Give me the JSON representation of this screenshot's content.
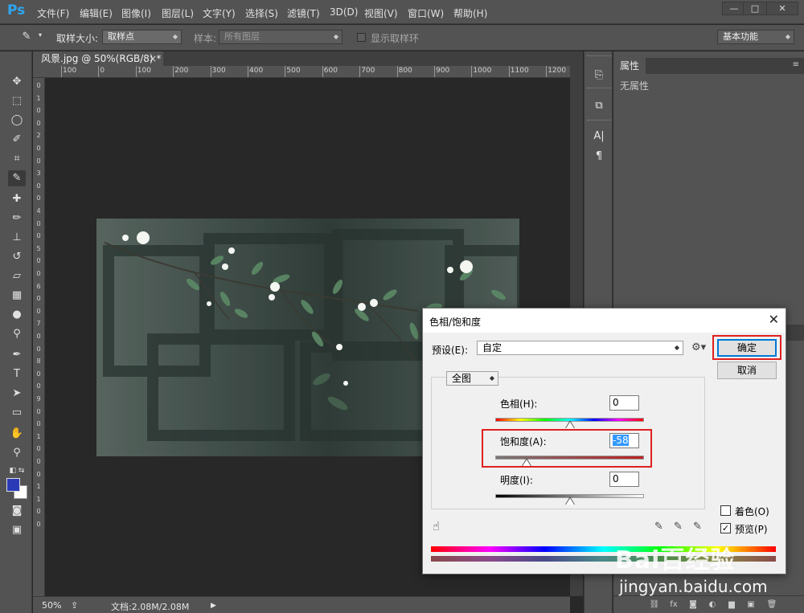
{
  "app": {
    "logo": "Ps"
  },
  "menu": [
    "文件(F)",
    "编辑(E)",
    "图像(I)",
    "图层(L)",
    "文字(Y)",
    "选择(S)",
    "滤镜(T)",
    "3D(D)",
    "视图(V)",
    "窗口(W)",
    "帮助(H)"
  ],
  "window_buttons": {
    "minimize": "—",
    "restore": "□",
    "close": "✕"
  },
  "options": {
    "sample_size_label": "取样大小:",
    "sample_size_value": "取样点",
    "sample_label": "样本:",
    "sample_value": "所有图层",
    "show_ring_label": "显示取样环",
    "workspace": "基本功能"
  },
  "document": {
    "tab_title": "风景.jpg @ 50%(RGB/8) *",
    "tab_close": "×",
    "zoom": "50%",
    "doc_info": "文档:2.08M/2.08M",
    "ruler_top": [
      "100",
      "0",
      "100",
      "200",
      "300",
      "400",
      "500",
      "600",
      "700",
      "800",
      "900",
      "1000",
      "1100",
      "1200"
    ],
    "ruler_left": [
      "0",
      "1",
      "0",
      "0",
      "2",
      "0",
      "0",
      "3",
      "0",
      "0",
      "4",
      "0",
      "0",
      "5",
      "0",
      "0",
      "6",
      "0",
      "0",
      "7",
      "0",
      "0",
      "8",
      "0",
      "0",
      "9",
      "0",
      "0",
      "1",
      "0",
      "0",
      "0",
      "1",
      "1",
      "0",
      "0"
    ]
  },
  "properties_panel": {
    "tab": "属性",
    "empty_text": "无属性"
  },
  "dialog": {
    "title": "色相/饱和度",
    "close": "✕",
    "preset_label": "预设(E):",
    "preset_value": "自定",
    "ok": "确定",
    "cancel": "取消",
    "channel": "全图",
    "hue_label": "色相(H):",
    "hue_value": "0",
    "saturation_label": "饱和度(A):",
    "saturation_value": "-58",
    "lightness_label": "明度(I):",
    "lightness_value": "0",
    "colorize_label": "着色(O)",
    "colorize_checked": false,
    "preview_label": "预览(P)",
    "preview_checked": true,
    "slider_levels": {
      "hue": 0.5,
      "saturation": 0.21,
      "lightness": 0.5
    }
  },
  "colors": {
    "ps_blue": "#2ea6f0",
    "foreground": "#2b3bb8",
    "background": "#ffffff",
    "highlight": "#e02020"
  },
  "watermark": {
    "logo": "Bai百经验",
    "url": "jingyan.baidu.com"
  }
}
